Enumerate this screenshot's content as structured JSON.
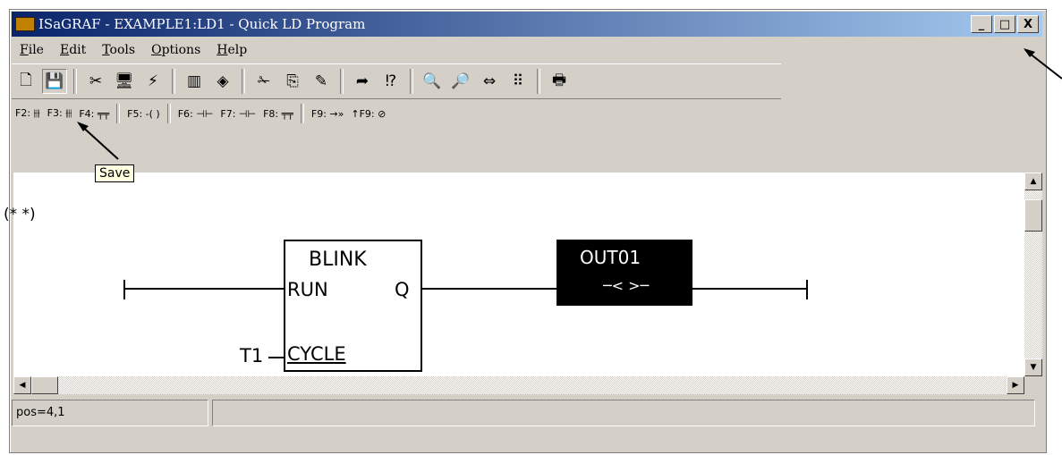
{
  "window": {
    "title": "ISaGRAF - EXAMPLE1:LD1 - Quick LD Program",
    "buttons": [
      "_",
      "□",
      "X"
    ]
  },
  "menu": [
    {
      "label": "File",
      "accel": "F",
      "rest": "ile"
    },
    {
      "label": "Edit",
      "accel": "E",
      "rest": "dit"
    },
    {
      "label": "Tools",
      "accel": "T",
      "rest": "ools"
    },
    {
      "label": "Options",
      "accel": "O",
      "rest": "ptions"
    },
    {
      "label": "Help",
      "accel": "H",
      "rest": "elp"
    }
  ],
  "toolbar_icons": [
    "new-icon",
    "save-icon",
    "cut-tool-icon",
    "monitor-icon",
    "network-icon",
    "library-icon",
    "diamond-icon",
    "scissors-icon",
    "copy-icon",
    "paste-icon",
    "goto-icon",
    "search-replace-icon",
    "zoom-out-icon",
    "zoom-in-icon",
    "resize-icon",
    "grid-icon",
    "print-icon"
  ],
  "keybar": {
    "f2": "F2: ⫲⫲",
    "f3": "F3: ⫲⫲",
    "f4": "F4: ╤╤",
    "f5": "F5: -( )",
    "f6": "F6: ⊣⊢",
    "f7": "F7: ⊣⊢",
    "f8": "F8: ╤╤",
    "f9": "F9: →»",
    "sf9": "↑F9: ⊘"
  },
  "tooltip": "Save",
  "ladder": {
    "comment": "(*  *)",
    "block_name": "BLINK",
    "input_run": "RUN",
    "output_q": "Q",
    "input_cycle": "CYCLE",
    "cycle_var": "T1",
    "coil_name": "OUT01",
    "coil_symbol": "─< >─"
  },
  "status": {
    "position": "pos=4,1",
    "extra": ""
  }
}
